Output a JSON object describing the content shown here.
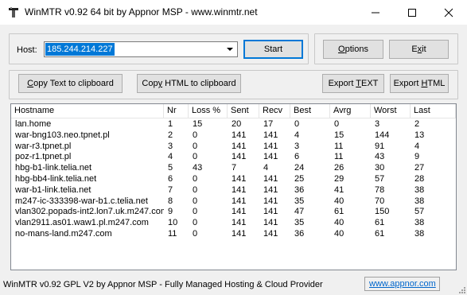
{
  "window": {
    "title": "WinMTR v0.92 64 bit by Appnor MSP - www.winmtr.net"
  },
  "host": {
    "label": "Host:",
    "value": "185.244.214.227",
    "start_label": "Start"
  },
  "buttons": {
    "options": {
      "pre": "",
      "u": "O",
      "post": "ptions"
    },
    "exit": {
      "pre": "E",
      "u": "x",
      "post": "it"
    },
    "copy_text": {
      "pre": "",
      "u": "C",
      "post": "opy Text to clipboard"
    },
    "copy_html": {
      "pre": "Cop",
      "u": "y",
      "post": " HTML to clipboard"
    },
    "export_text": {
      "pre": "Export ",
      "u": "T",
      "post": "EXT"
    },
    "export_html": {
      "pre": "Export ",
      "u": "H",
      "post": "TML"
    }
  },
  "table": {
    "columns": [
      "Hostname",
      "Nr",
      "Loss %",
      "Sent",
      "Recv",
      "Best",
      "Avrg",
      "Worst",
      "Last"
    ],
    "rows": [
      [
        "lan.home",
        "1",
        "15",
        "20",
        "17",
        "0",
        "0",
        "3",
        "2"
      ],
      [
        "war-bng103.neo.tpnet.pl",
        "2",
        "0",
        "141",
        "141",
        "4",
        "15",
        "144",
        "13"
      ],
      [
        "war-r3.tpnet.pl",
        "3",
        "0",
        "141",
        "141",
        "3",
        "11",
        "91",
        "4"
      ],
      [
        "poz-r1.tpnet.pl",
        "4",
        "0",
        "141",
        "141",
        "6",
        "11",
        "43",
        "9"
      ],
      [
        "hbg-b1-link.telia.net",
        "5",
        "43",
        "7",
        "4",
        "24",
        "26",
        "30",
        "27"
      ],
      [
        "hbg-bb4-link.telia.net",
        "6",
        "0",
        "141",
        "141",
        "25",
        "29",
        "57",
        "28"
      ],
      [
        "war-b1-link.telia.net",
        "7",
        "0",
        "141",
        "141",
        "36",
        "41",
        "78",
        "38"
      ],
      [
        "m247-ic-333398-war-b1.c.telia.net",
        "8",
        "0",
        "141",
        "141",
        "35",
        "40",
        "70",
        "38"
      ],
      [
        "vlan302.popads-int2.lon7.uk.m247.com",
        "9",
        "0",
        "141",
        "141",
        "47",
        "61",
        "150",
        "57"
      ],
      [
        "vlan2911.as01.waw1.pl.m247.com",
        "10",
        "0",
        "141",
        "141",
        "35",
        "40",
        "61",
        "38"
      ],
      [
        "no-mans-land.m247.com",
        "11",
        "0",
        "141",
        "141",
        "36",
        "40",
        "61",
        "38"
      ]
    ]
  },
  "status": {
    "text": "WinMTR v0.92 GPL V2 by Appnor MSP - Fully Managed Hosting & Cloud Provider",
    "link": "www.appnor.com"
  },
  "icons": {
    "app": "app-hammer-icon",
    "minimize": "minimize-icon",
    "maximize": "maximize-icon",
    "close": "close-icon",
    "dropdown": "chevron-down-icon",
    "grip": "resize-grip-icon"
  }
}
